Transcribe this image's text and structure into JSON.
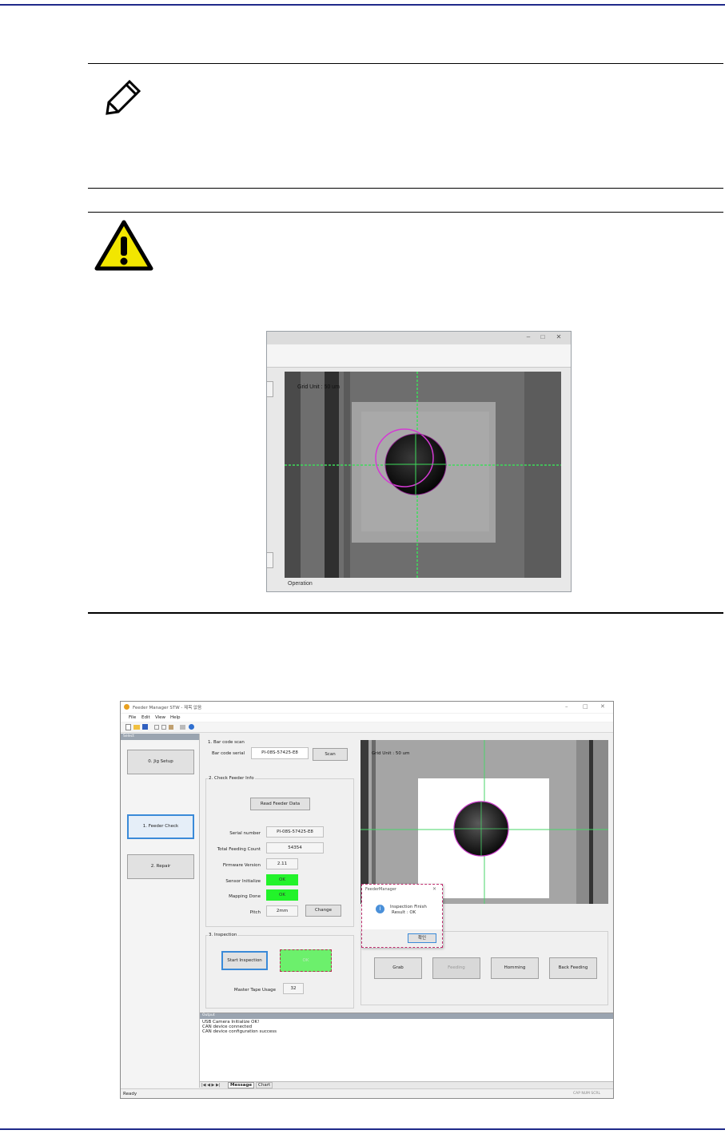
{
  "page": {
    "note_icon": "pencil-note-icon",
    "warning_icon": "warning-triangle-icon"
  },
  "camera_top": {
    "grid_unit_label": "Grid Unit : 50 um",
    "operation_label": "Operation"
  },
  "app": {
    "title": "Feeder Manager STW - 제목 없음",
    "window_controls": [
      "–",
      "□",
      "✕"
    ],
    "menu": [
      "File",
      "Edit",
      "View",
      "Help"
    ],
    "left_pane_title": "Select",
    "nav_buttons": [
      "0. Jig Setup",
      "1. Feeder Check",
      "2. Repair"
    ],
    "bar_code": {
      "section_title": "1. Bar code scan",
      "label": "Bar code serial",
      "value": "PI-08S-57425-E8",
      "scan_button": "Scan"
    },
    "check_info": {
      "section_title": "2. Check Feeder Info",
      "read_button": "Read Feeder Data",
      "serial_label": "Serial number",
      "serial_value": "PI-08S-57425-E8",
      "feeding_label": "Total Feeding Count",
      "feeding_value": "54354",
      "firmware_label": "Firmware Version",
      "firmware_value": "2.11",
      "sensor_label": "Sensor Initialize",
      "sensor_value": "OK",
      "mapping_label": "Mapping Done",
      "mapping_value": "OK",
      "pitch_label": "Pitch",
      "pitch_value": "2mm",
      "change_button": "Change"
    },
    "inspection": {
      "section_title": "3. Inspection",
      "start_button": "Start Inspection",
      "result_value": "OK",
      "tape_label": "Master Tape Usage",
      "tape_value": "32"
    },
    "camera": {
      "grid_unit_label": "Grid Unit : 50 um"
    },
    "dialog": {
      "title": "FeederManager",
      "close": "✕",
      "line1": "Inspection Finish",
      "line2": "Result : OK",
      "ok_button": "확인"
    },
    "camera_buttons": [
      "Grab",
      "Feeding",
      "Homming",
      "Back Feeding"
    ],
    "output": {
      "title": "Output",
      "lines": [
        "USB Camera Initialize OK!",
        "CAN device connected",
        "CAN device configuration success"
      ],
      "tabs": [
        "Message",
        "Chart"
      ]
    },
    "status": {
      "left": "Ready",
      "right": "CAP NUM SCRL"
    }
  }
}
